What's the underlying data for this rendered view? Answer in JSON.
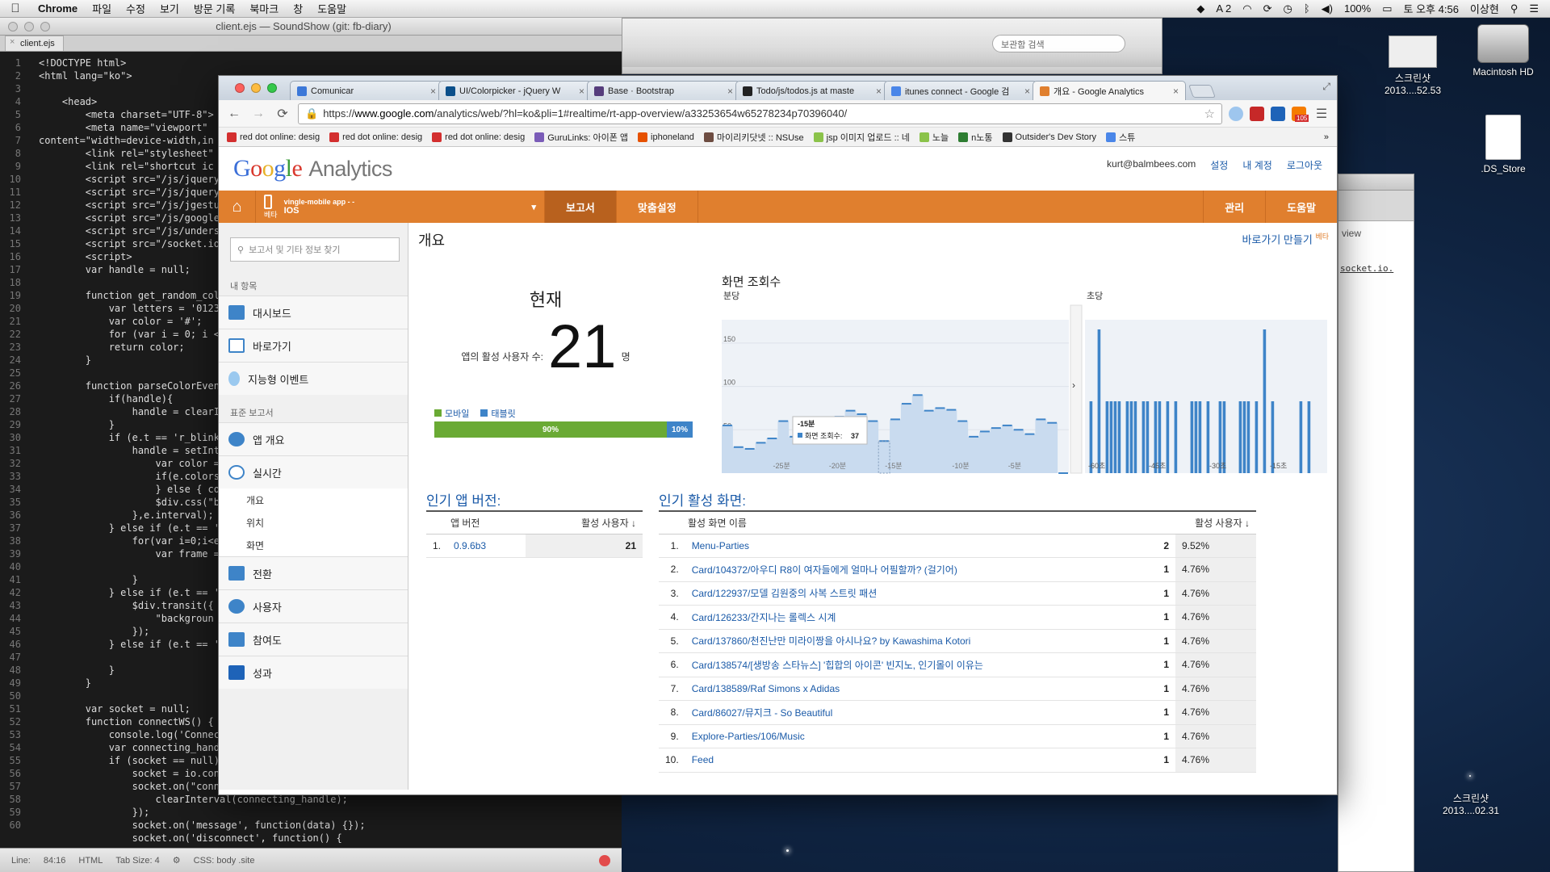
{
  "menubar": {
    "app": "Chrome",
    "items": [
      "파일",
      "수정",
      "보기",
      "방문 기록",
      "북마크",
      "창",
      "도움말"
    ],
    "status": {
      "extra": "2",
      "battery": "100%",
      "clock": "토 오후 4:56",
      "user": "이상현"
    }
  },
  "desktop": {
    "icons": [
      {
        "label": "Macintosh HD"
      },
      {
        "label": ".DS_Store"
      },
      {
        "label": "스크린샷",
        "sub": "2013....52.53"
      },
      {
        "label": "스크린샷",
        "sub": "2013....02.31"
      }
    ],
    "bg_window": {
      "search_placeholder": "보관함 검색",
      "text1": "view",
      "text2": "socket.io."
    }
  },
  "editor": {
    "title": "client.ejs — SoundShow (git: fb-diary)",
    "tab": "client.ejs",
    "line_numbers": [
      "1",
      "2",
      "3",
      "4",
      "5",
      "6",
      "7",
      "8",
      "9",
      "10",
      "11",
      "12",
      "13",
      "14",
      "15",
      "16",
      "17",
      "18",
      "19",
      "20",
      "21",
      "22",
      "23",
      "24",
      "25",
      "26",
      "27",
      "28",
      "29",
      "30",
      "31",
      "32",
      "33",
      "34",
      "35",
      "36",
      "37",
      "38",
      "39",
      "40",
      "41",
      "42",
      "43",
      "44",
      "45",
      "46",
      "47",
      "48",
      "49",
      "50",
      "51",
      "52",
      "53",
      "54",
      "55",
      "56",
      "57",
      "58",
      "59",
      "60"
    ],
    "code_lines": [
      "<!DOCTYPE html>",
      "<html lang=\"ko\">",
      "",
      "    <head>",
      "        <meta charset=\"UTF-8\">",
      "        <meta name=\"viewport\"",
      "content=\"width=device-width,in",
      "        <link rel=\"stylesheet\"",
      "        <link rel=\"shortcut ic",
      "        <script src=\"/js/jquery",
      "        <script src=\"/js/jquery",
      "        <script src=\"/js/jgestu",
      "        <script src=\"/js/google",
      "        <script src=\"/js/unders",
      "        <script src=\"/socket.io",
      "        <script>",
      "        var handle = null;",
      "",
      "        function get_random_col",
      "            var letters = '0123",
      "            var color = '#';",
      "            for (var i = 0; i <",
      "            return color;",
      "        }",
      "",
      "        function parseColorEven",
      "            if(handle){",
      "                handle = clearI",
      "            }",
      "            if (e.t == 'r_blink",
      "                handle = setInt",
      "                    var color =",
      "                    if(e.colors",
      "                    } else { co",
      "                    $div.css(\"b",
      "                },e.interval);",
      "            } else if (e.t == '",
      "                for(var i=0;i<e",
      "                    var frame =",
      "",
      "                }",
      "            } else if (e.t == '",
      "                $div.transit({",
      "                    \"backgroun",
      "                });",
      "            } else if (e.t == '",
      "",
      "            }",
      "        }",
      "",
      "        var socket = null;",
      "        function connectWS() {",
      "            console.log('Connec",
      "            var connecting_hand",
      "            if (socket == null)",
      "                socket = io.con",
      "                socket.on(\"conn",
      "                    clearInterval(connecting_handle);",
      "                });",
      "                socket.on('message', function(data) {});",
      "                socket.on('disconnect', function() {"
    ],
    "status": {
      "line_label": "Line:",
      "position": "84:16",
      "language": "HTML",
      "tab_size": "Tab Size:  4",
      "css_path": "CSS: body .site"
    }
  },
  "browser": {
    "tabs": [
      {
        "title": "Comunicar",
        "color": "#3c78d8"
      },
      {
        "title": "UI/Colorpicker - jQuery W",
        "color": "#0b4f8a"
      },
      {
        "title": "Base · Bootstrap",
        "color": "#563d7c"
      },
      {
        "title": "Todo/js/todos.js at maste",
        "color": "#222222"
      },
      {
        "title": "itunes connect - Google 검",
        "color": "#4a86e8"
      },
      {
        "title": "개요 - Google Analytics",
        "color": "#e07f2e"
      }
    ],
    "url_scheme": "https://",
    "url_host": "www.google.com",
    "url_path": "/analytics/web/?hl=ko&pli=1#realtime/rt-app-overview/a33253654w65278234p70396040/",
    "ext_badge": "105",
    "bookmarks": [
      "red dot online: desig",
      "red dot online: desig",
      "red dot online: desig",
      "GuruLinks: 아이폰 앱",
      "iphoneland",
      "마이리키닷넷 :: NSUse",
      "jsp 이미지 업로드 :: 네",
      "노늘",
      "n노통",
      "Outsider's Dev Story",
      "스튜"
    ]
  },
  "ga": {
    "user_email": "kurt@balmbees.com",
    "links": [
      "설정",
      "내 계정",
      "로그아웃"
    ],
    "nav": {
      "property_name": "vingle-mobile app - -",
      "property_sub": "IOS",
      "badge": "베타",
      "reports": "보고서",
      "custom": "맞춤설정",
      "admin": "관리",
      "help": "도움말"
    },
    "sidebar": {
      "search_placeholder": "보고서 및 기타 정보 찾기",
      "my_items_heading": "내 항목",
      "my_items": [
        "대시보드",
        "바로가기",
        "지능형 이벤트"
      ],
      "standard_heading": "표준 보고서",
      "app_overview": "앱 개요",
      "realtime": "실시간",
      "realtime_sub": [
        "개요",
        "위치",
        "화면"
      ],
      "more": [
        "전환",
        "사용자",
        "참여도",
        "성과"
      ]
    },
    "main": {
      "title": "개요",
      "shortcut": "바로가기 만들기",
      "shortcut_badge": "베타",
      "now_label": "현재",
      "active_users_label": "앱의 활성 사용자 수:",
      "active_users": "21",
      "unit": "명",
      "legend_mobile": "모바일",
      "legend_tablet": "태블릿",
      "mobile_pct": "90%",
      "tablet_pct": "10%"
    },
    "colors": {
      "mobile": "#6aaa34",
      "tablet": "#3e84c8",
      "nav": "#e07f2e"
    },
    "app_versions": {
      "title": "인기 앱 버전:",
      "col_version": "앱 버전",
      "col_users": "활성 사용자",
      "rows": [
        {
          "rank": "1.",
          "version": "0.9.6b3",
          "users": "21"
        }
      ]
    },
    "active_screens": {
      "title": "인기 활성 화면:",
      "col_name": "활성 화면 이름",
      "col_users": "활성 사용자",
      "rows": [
        {
          "rank": "1.",
          "name": "Menu-Parties",
          "users": "2",
          "pct": "9.52%"
        },
        {
          "rank": "2.",
          "name": "Card/104372/아우디 R8이 여자들에게 얼마나 어필할까? (걸기어)",
          "users": "1",
          "pct": "4.76%"
        },
        {
          "rank": "3.",
          "name": "Card/122937/모델 김원중의 사복 스트릿 패션",
          "users": "1",
          "pct": "4.76%"
        },
        {
          "rank": "4.",
          "name": "Card/126233/간지나는 롤렉스 시계",
          "users": "1",
          "pct": "4.76%"
        },
        {
          "rank": "5.",
          "name": "Card/137860/천진난만 미라이짱을 아시나요? by Kawashima Kotori",
          "users": "1",
          "pct": "4.76%"
        },
        {
          "rank": "6.",
          "name": "Card/138574/[생방송 스타뉴스] '힙합의 아이콘' 빈지노, 인기몰이 이유는",
          "users": "1",
          "pct": "4.76%"
        },
        {
          "rank": "7.",
          "name": "Card/138589/Raf Simons x Adidas",
          "users": "1",
          "pct": "4.76%"
        },
        {
          "rank": "8.",
          "name": "Card/86027/뮤지크 - So Beautiful",
          "users": "1",
          "pct": "4.76%"
        },
        {
          "rank": "9.",
          "name": "Explore-Parties/106/Music",
          "users": "1",
          "pct": "4.76%"
        },
        {
          "rank": "10.",
          "name": "Feed",
          "users": "1",
          "pct": "4.76%"
        }
      ]
    }
  },
  "chart_data": {
    "type": "bar",
    "title": "화면 조회수",
    "panels": [
      {
        "name": "분당",
        "ylim": [
          0,
          175
        ],
        "yticks": [
          50,
          100,
          150
        ],
        "xticks": [
          "-25분",
          "-20분",
          "-15분",
          "-10분",
          "-5분"
        ],
        "values": [
          55,
          30,
          28,
          35,
          40,
          60,
          42,
          38,
          55,
          60,
          65,
          72,
          68,
          60,
          37,
          62,
          80,
          90,
          72,
          75,
          73,
          60,
          42,
          48,
          52,
          55,
          50,
          45,
          62,
          58,
          0
        ]
      },
      {
        "name": "초당",
        "xticks": [
          "-60초",
          "-45초",
          "-30초",
          "-15초"
        ],
        "values": [
          0,
          1,
          0,
          2,
          0,
          1,
          1,
          1,
          1,
          0,
          1,
          1,
          1,
          0,
          1,
          1,
          0,
          1,
          1,
          0,
          1,
          0,
          1,
          0,
          0,
          0,
          1,
          1,
          1,
          0,
          1,
          0,
          0,
          1,
          1,
          0,
          0,
          0,
          1,
          1,
          1,
          0,
          1,
          0,
          2,
          0,
          1,
          0,
          0,
          0,
          0,
          0,
          0,
          1,
          0,
          1,
          0,
          0,
          0,
          0
        ]
      }
    ],
    "tooltip": {
      "time": "-15분",
      "label": "화면 조회수:",
      "value": "37"
    }
  }
}
